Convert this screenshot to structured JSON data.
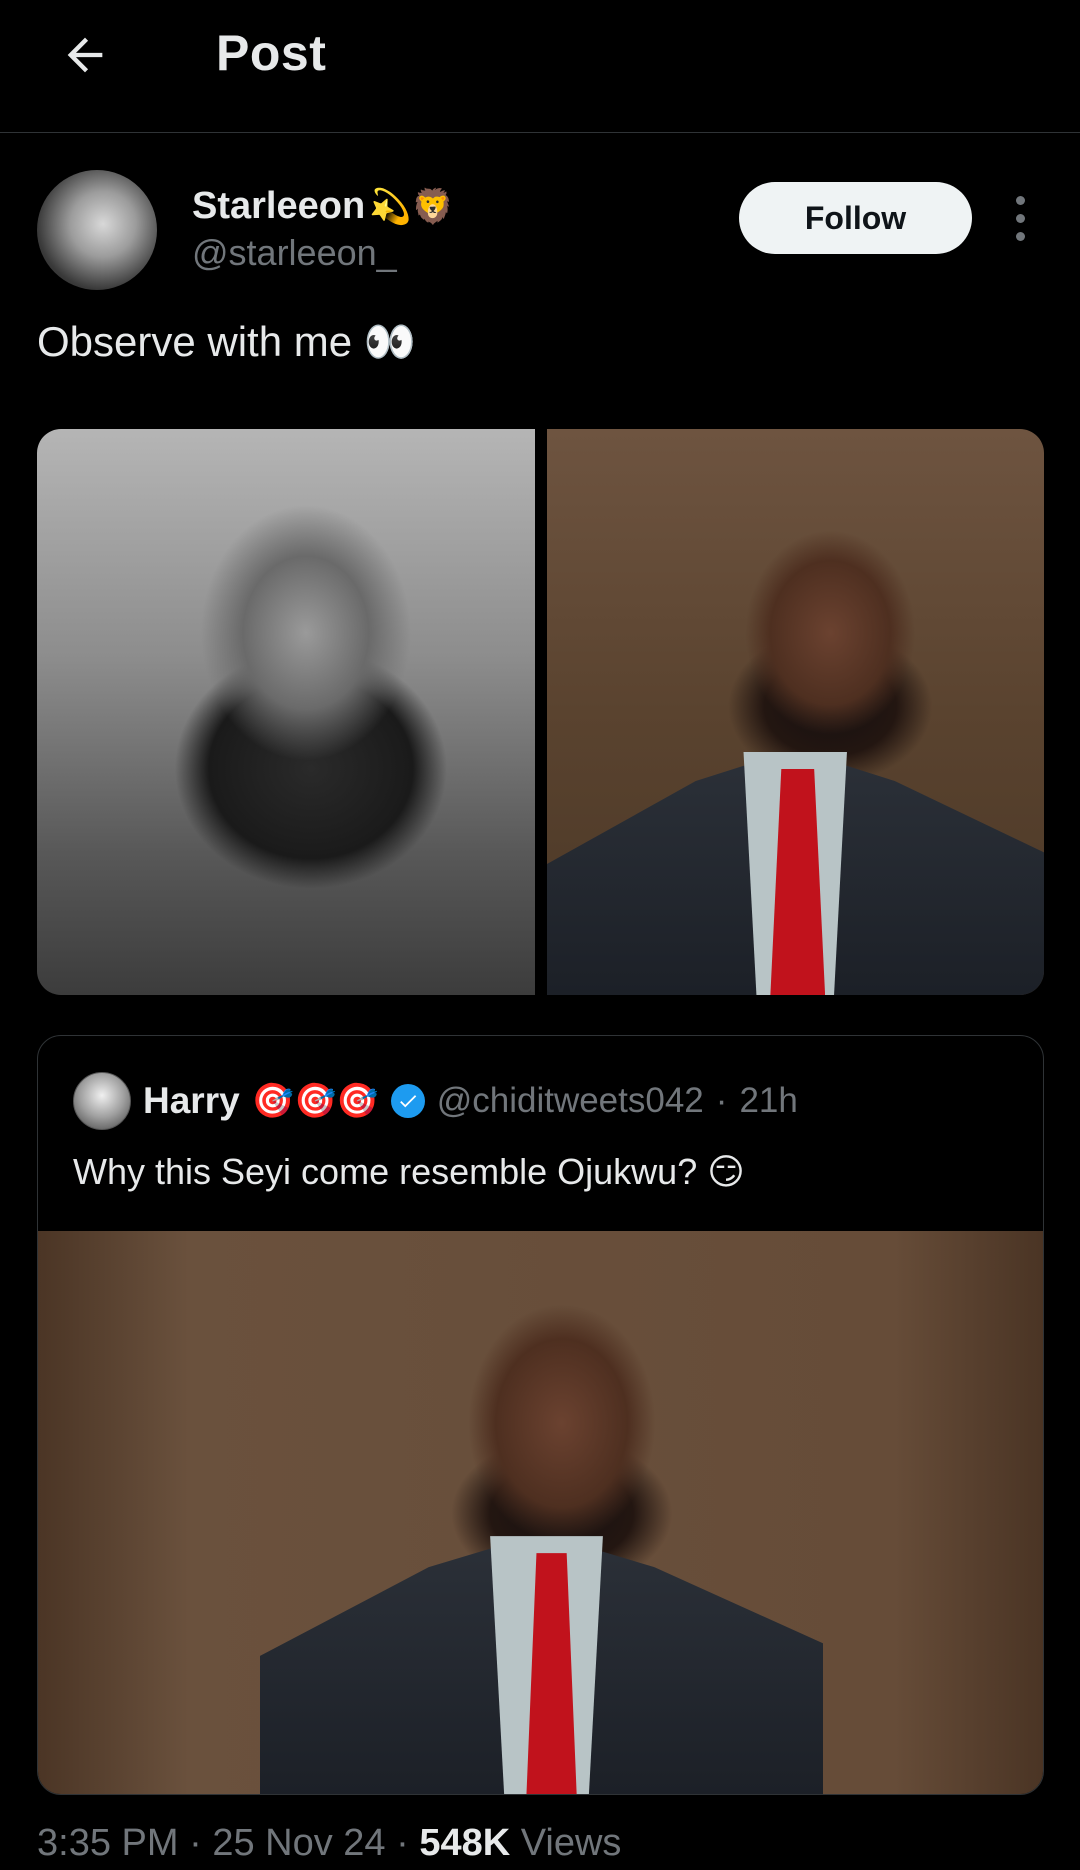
{
  "header": {
    "title": "Post",
    "back_icon": "arrow-left-icon"
  },
  "author": {
    "display_name": "Starleeon",
    "name_emojis": "💫🦁",
    "handle": "@starleeon_",
    "follow_label": "Follow",
    "more_icon": "vertical-ellipsis-icon"
  },
  "post": {
    "text": "Observe with me 👀",
    "media": [
      {
        "kind": "photo",
        "tone": "black-and-white portrait"
      },
      {
        "kind": "photo",
        "tone": "color portrait, suit and red tie"
      }
    ]
  },
  "quote": {
    "display_name": "Harry",
    "name_emojis": "🎯🎯🎯",
    "verified": true,
    "handle": "@chiditweets042",
    "separator": "·",
    "time_ago": "21h",
    "text": "Why this Seyi come resemble Ojukwu? 😏"
  },
  "meta": {
    "time": "3:35 PM",
    "date": "25 Nov 24",
    "separator": "·",
    "views_count": "548K",
    "views_label": "Views"
  },
  "colors": {
    "background": "#000000",
    "text_primary": "#e7e9ea",
    "text_secondary": "#71767b",
    "divider": "#2f3336",
    "verified_blue": "#1d9bf0",
    "follow_bg": "#eff3f4"
  }
}
